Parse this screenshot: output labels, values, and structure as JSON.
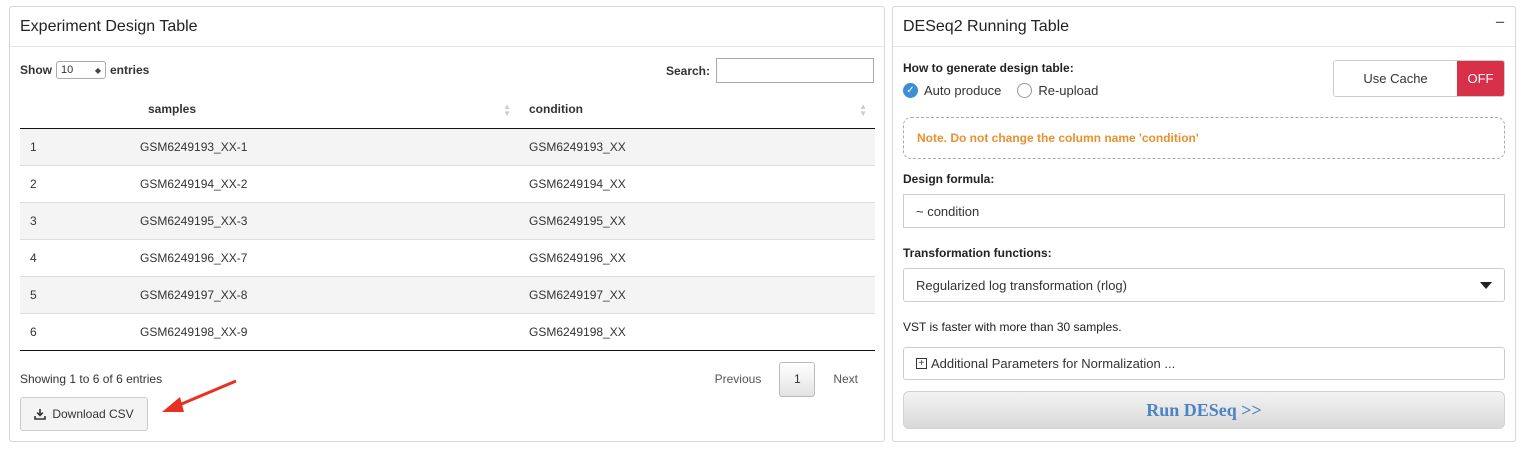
{
  "left_panel": {
    "title": "Experiment Design Table",
    "show_label": "Show",
    "page_length": "10",
    "entries_label": "entries",
    "search_label": "Search:",
    "columns": [
      "",
      "samples",
      "condition"
    ],
    "rows": [
      [
        "1",
        "GSM6249193_XX-1",
        "GSM6249193_XX"
      ],
      [
        "2",
        "GSM6249194_XX-2",
        "GSM6249194_XX"
      ],
      [
        "3",
        "GSM6249195_XX-3",
        "GSM6249195_XX"
      ],
      [
        "4",
        "GSM6249196_XX-7",
        "GSM6249196_XX"
      ],
      [
        "5",
        "GSM6249197_XX-8",
        "GSM6249197_XX"
      ],
      [
        "6",
        "GSM6249198_XX-9",
        "GSM6249198_XX"
      ]
    ],
    "info": "Showing 1 to 6 of 6 entries",
    "pager": {
      "previous": "Previous",
      "current": "1",
      "next": "Next"
    },
    "download_label": "Download CSV"
  },
  "right_panel": {
    "title": "DESeq2 Running Table",
    "collapse_symbol": "−",
    "design_label": "How to generate design table:",
    "radio_options": [
      {
        "label": "Auto produce",
        "selected": true
      },
      {
        "label": "Re-upload",
        "selected": false
      }
    ],
    "cache": {
      "label": "Use Cache",
      "state": "OFF"
    },
    "note": "Note. Do not change the column name 'condition'",
    "formula_label": "Design formula:",
    "formula_value": "~ condition",
    "transform_label": "Transformation functions:",
    "transform_value": "Regularized log transformation (rlog)",
    "hint": "VST is faster with more than 30 samples.",
    "additional_label": "Additional Parameters for Normalization ...",
    "run_label": "Run DESeq >>"
  },
  "colors": {
    "off_red": "#d9304a",
    "note_orange": "#e8912d",
    "radio_blue": "#3b8fd6",
    "run_blue": "#4b84c4",
    "arrow_red": "#e53222"
  }
}
